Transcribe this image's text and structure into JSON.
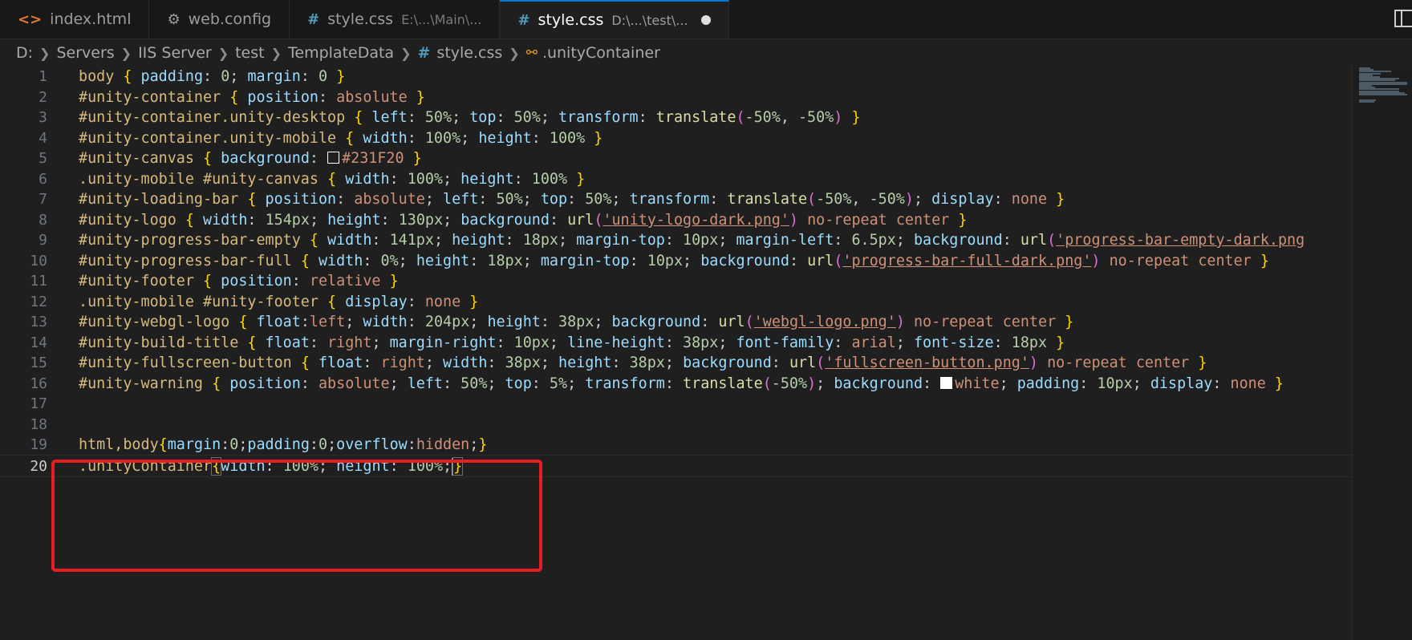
{
  "tabs": [
    {
      "icon": "html-file-icon",
      "glyph": "<>",
      "label": "index.html",
      "desc": "",
      "active": false
    },
    {
      "icon": "gear-icon",
      "glyph": "⚙",
      "label": "web.config",
      "desc": "",
      "active": false
    },
    {
      "icon": "css-file-icon",
      "glyph": "#",
      "label": "style.css",
      "desc": "E:\\...\\Main\\...",
      "active": false
    },
    {
      "icon": "css-file-icon",
      "glyph": "#",
      "label": "style.css",
      "desc": "D:\\...\\test\\...",
      "active": true,
      "dirty": true
    }
  ],
  "breadcrumb": {
    "items": [
      "D:",
      "Servers",
      "IIS Server",
      "test",
      "TemplateData"
    ],
    "file": "style.css",
    "symbol": ".unityContainer"
  },
  "editor": {
    "current_line": 20,
    "line_numbers": [
      "1",
      "2",
      "3",
      "4",
      "5",
      "6",
      "7",
      "8",
      "9",
      "10",
      "11",
      "12",
      "13",
      "14",
      "15",
      "16",
      "17",
      "18",
      "19",
      "20"
    ],
    "lines": [
      "body { padding: 0; margin: 0 }",
      "#unity-container { position: absolute }",
      "#unity-container.unity-desktop { left: 50%; top: 50%; transform: translate(-50%, -50%) }",
      "#unity-container.unity-mobile { width: 100%; height: 100% }",
      "#unity-canvas { background: #231F20 }",
      ".unity-mobile #unity-canvas { width: 100%; height: 100% }",
      "#unity-loading-bar { position: absolute; left: 50%; top: 50%; transform: translate(-50%, -50%); display: none }",
      "#unity-logo { width: 154px; height: 130px; background: url('unity-logo-dark.png') no-repeat center }",
      "#unity-progress-bar-empty { width: 141px; height: 18px; margin-top: 10px; margin-left: 6.5px; background: url('progress-bar-empty-dark.png",
      "#unity-progress-bar-full { width: 0%; height: 18px; margin-top: 10px; background: url('progress-bar-full-dark.png') no-repeat center }",
      "#unity-footer { position: relative }",
      ".unity-mobile #unity-footer { display: none }",
      "#unity-webgl-logo { float:left; width: 204px; height: 38px; background: url('webgl-logo.png') no-repeat center }",
      "#unity-build-title { float: right; margin-right: 10px; line-height: 38px; font-family: arial; font-size: 18px }",
      "#unity-fullscreen-button { float: right; width: 38px; height: 38px; background: url('fullscreen-button.png') no-repeat center }",
      "#unity-warning { position: absolute; left: 50%; top: 5%; transform: translate(-50%); background: white; padding: 10px; display: none }",
      "",
      "",
      "html,body{margin:0;padding:0;overflow:hidden;}",
      ".unityContainer{width: 100%; height: 100%;}"
    ],
    "swatches": {
      "line5": "#231F20",
      "line16": "#ffffff"
    }
  },
  "colors": {
    "highlight_box": "#e81e23",
    "background": "#1f1f1f",
    "accent": "#0078d4"
  }
}
